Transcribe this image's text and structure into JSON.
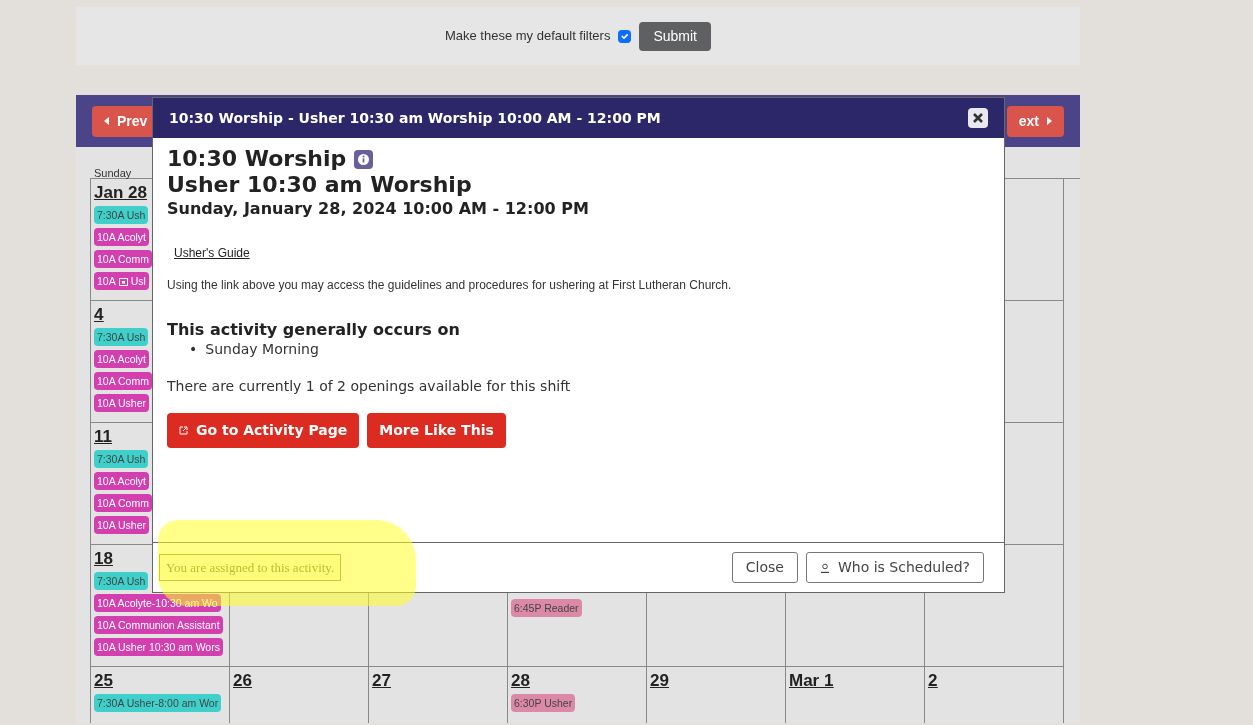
{
  "filters": {
    "label": "Make these my default filters",
    "checked": true,
    "submit": "Submit"
  },
  "calendar": {
    "prev": "Prev",
    "next": "ext",
    "weekdays": [
      "Sunday"
    ],
    "weeks": [
      {
        "days": [
          {
            "month": "Jan",
            "day": "28",
            "events": [
              {
                "time": "7:30A",
                "title": "Ush",
                "color": "#3fd0cb"
              },
              {
                "time": "10A",
                "title": "Acolyt",
                "color": "#d33fae"
              },
              {
                "time": "10A",
                "title": "Comm",
                "color": "#d33fae"
              },
              {
                "time": "10A",
                "title": "Usl",
                "color": "#d33fae",
                "has_icon": true
              }
            ]
          }
        ]
      },
      {
        "days": [
          {
            "day": "4",
            "events": [
              {
                "time": "7:30A",
                "title": "Ush",
                "color": "#3fd0cb"
              },
              {
                "time": "10A",
                "title": "Acolyt",
                "color": "#d33fae"
              },
              {
                "time": "10A",
                "title": "Comm",
                "color": "#d33fae"
              },
              {
                "time": "10A",
                "title": "Usher",
                "color": "#d33fae"
              }
            ]
          }
        ]
      },
      {
        "days": [
          {
            "day": "11",
            "events": [
              {
                "time": "7:30A",
                "title": "Ush",
                "color": "#3fd0cb"
              },
              {
                "time": "10A",
                "title": "Acolyt",
                "color": "#d33fae"
              },
              {
                "time": "10A",
                "title": "Comm",
                "color": "#d33fae"
              },
              {
                "time": "10A",
                "title": "Usher",
                "color": "#d33fae"
              }
            ]
          }
        ]
      },
      {
        "days": [
          {
            "day": "18",
            "events": [
              {
                "time": "7:30A",
                "title": "Ush",
                "color": "#3fd0cb"
              },
              {
                "time": "10A",
                "title": "Acolyte-10:30 am Wo",
                "color": "#d33fae"
              },
              {
                "time": "10A",
                "title": "Communion Assistant",
                "color": "#d33fae"
              },
              {
                "time": "10A",
                "title": "Usher 10:30 am Wors",
                "color": "#d33fae"
              }
            ]
          }
        ],
        "column_4": {
          "events": [
            {
              "time": "6:45P",
              "title": "Reader",
              "color": "#dc89a7"
            }
          ]
        }
      },
      {
        "days": [
          {
            "day": "25",
            "events": [
              {
                "time": "7:30A",
                "title": "Usher-8:00 am Wor",
                "color": "#3fd0cb"
              }
            ]
          },
          {
            "day": "26"
          },
          {
            "day": "27"
          },
          {
            "day": "28",
            "events": [
              {
                "time": "6:30P",
                "title": "Usher",
                "color": "#dc89a7"
              }
            ]
          },
          {
            "day": "29"
          },
          {
            "month": "Mar",
            "day": "1"
          },
          {
            "day": "2"
          }
        ]
      }
    ]
  },
  "modal": {
    "title": "10:30 Worship - Usher 10:30 am Worship 10:00 AM - 12:00 PM",
    "heading": "10:30 Worship",
    "subheading": "Usher 10:30 am Worship",
    "date": "Sunday, January 28, 2024 10:00 AM - 12:00 PM",
    "link": "Usher's Guide",
    "description": "Using the link above you may access the guidelines and procedures for ushering at First Lutheran Church.",
    "occurs_heading": "This activity generally occurs on",
    "occurs": [
      {
        "bullet": "•",
        "text": "Sunday Morning"
      }
    ],
    "openings": "There are currently 1 of 2 openings available for this shift",
    "buttons": [
      "Go to Activity Page",
      "More Like This"
    ],
    "notice": "You are assigned to this activity.",
    "close": "Close",
    "who": "Who is Scheduled?"
  }
}
